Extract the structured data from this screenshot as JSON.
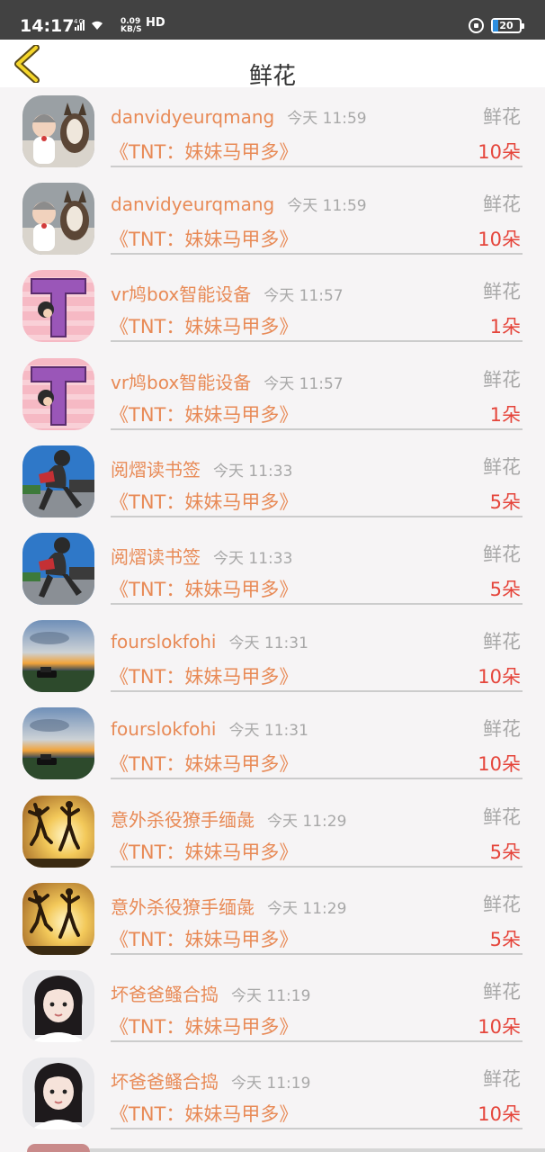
{
  "status_bar": {
    "time": "14:17",
    "network": "4G",
    "speed_value": "0.09",
    "speed_unit": "KB/S",
    "hd": "HD",
    "battery": "20"
  },
  "header": {
    "title": "鲜花"
  },
  "records": [
    {
      "name": "danvidyeurqmang",
      "time": "今天 11:59",
      "type": "鲜花",
      "book": "《TNT：妹妹马甲多》",
      "count": "10朵",
      "avatar": "child-dog"
    },
    {
      "name": "danvidyeurqmang",
      "time": "今天 11:59",
      "type": "鲜花",
      "book": "《TNT：妹妹马甲多》",
      "count": "10朵",
      "avatar": "child-dog"
    },
    {
      "name": "vr鸠box智能设备",
      "time": "今天 11:57",
      "type": "鲜花",
      "book": "《TNT：妹妹马甲多》",
      "count": "1朵",
      "avatar": "letter-t"
    },
    {
      "name": "vr鸠box智能设备",
      "time": "今天 11:57",
      "type": "鲜花",
      "book": "《TNT：妹妹马甲多》",
      "count": "1朵",
      "avatar": "letter-t"
    },
    {
      "name": "阅熠读书签",
      "time": "今天 11:33",
      "type": "鲜花",
      "book": "《TNT：妹妹马甲多》",
      "count": "5朵",
      "avatar": "runner"
    },
    {
      "name": "阅熠读书签",
      "time": "今天 11:33",
      "type": "鲜花",
      "book": "《TNT：妹妹马甲多》",
      "count": "5朵",
      "avatar": "runner"
    },
    {
      "name": "fourslokfohi",
      "time": "今天 11:31",
      "type": "鲜花",
      "book": "《TNT：妹妹马甲多》",
      "count": "10朵",
      "avatar": "sunset-car"
    },
    {
      "name": "fourslokfohi",
      "time": "今天 11:31",
      "type": "鲜花",
      "book": "《TNT：妹妹马甲多》",
      "count": "10朵",
      "avatar": "sunset-car"
    },
    {
      "name": "意外杀役獠手缅彘",
      "time": "今天 11:29",
      "type": "鲜花",
      "book": "《TNT：妹妹马甲多》",
      "count": "5朵",
      "avatar": "jumpers"
    },
    {
      "name": "意外杀役獠手缅彘",
      "time": "今天 11:29",
      "type": "鲜花",
      "book": "《TNT：妹妹马甲多》",
      "count": "5朵",
      "avatar": "jumpers"
    },
    {
      "name": "坏爸爸鳋合捣",
      "time": "今天 11:19",
      "type": "鲜花",
      "book": "《TNT：妹妹马甲多》",
      "count": "10朵",
      "avatar": "girl"
    },
    {
      "name": "坏爸爸鳋合捣",
      "time": "今天 11:19",
      "type": "鲜花",
      "book": "《TNT：妹妹马甲多》",
      "count": "10朵",
      "avatar": "girl"
    }
  ]
}
